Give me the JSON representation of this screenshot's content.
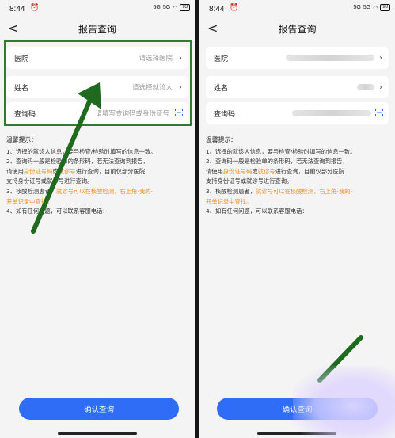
{
  "status_bar": {
    "time": "8:44",
    "signal_1": "5G",
    "signal_2": "5G",
    "battery": "93"
  },
  "page": {
    "title": "报告查询",
    "back": "<"
  },
  "form": {
    "hospital_label": "医院",
    "hospital_placeholder": "请选择医院",
    "name_label": "姓名",
    "name_placeholder": "请选择就诊人",
    "query_label": "查询码",
    "query_placeholder": "请填写查询码或身份证号"
  },
  "tips": {
    "title": "温馨提示：",
    "line1": "1、选择的就诊人信息，要与检查/检验时填写的信息一致。",
    "line2_a": "2、查询码一般是检验单的条形码，若无法查询到报告，",
    "line2_b_pre": "请使用",
    "line2_b_id": "身份证号码",
    "line2_b_or": "或",
    "line2_b_visit": "就诊号",
    "line2_b_post": "进行查询，目前仅部分医院",
    "line2_c": "支持身份证号或就诊号进行查询。",
    "line3_pre": "3、核酸检测患者，",
    "line3_orange_a": "就诊号可以在核酸检测，右上角-我的-",
    "line3_orange_b": "开单记录中查找。",
    "line4": "4、如有任何问题，可以联系客服电话："
  },
  "submit_label": "确认查询",
  "colors": {
    "primary": "#2f6df6",
    "highlight": "#2e7d2e",
    "arrow": "#1f6a1f",
    "tip_orange": "#f08a1c"
  },
  "icons": {
    "back": "chevron-left-icon",
    "chevron": "chevron-right-icon",
    "scan": "scan-icon"
  }
}
